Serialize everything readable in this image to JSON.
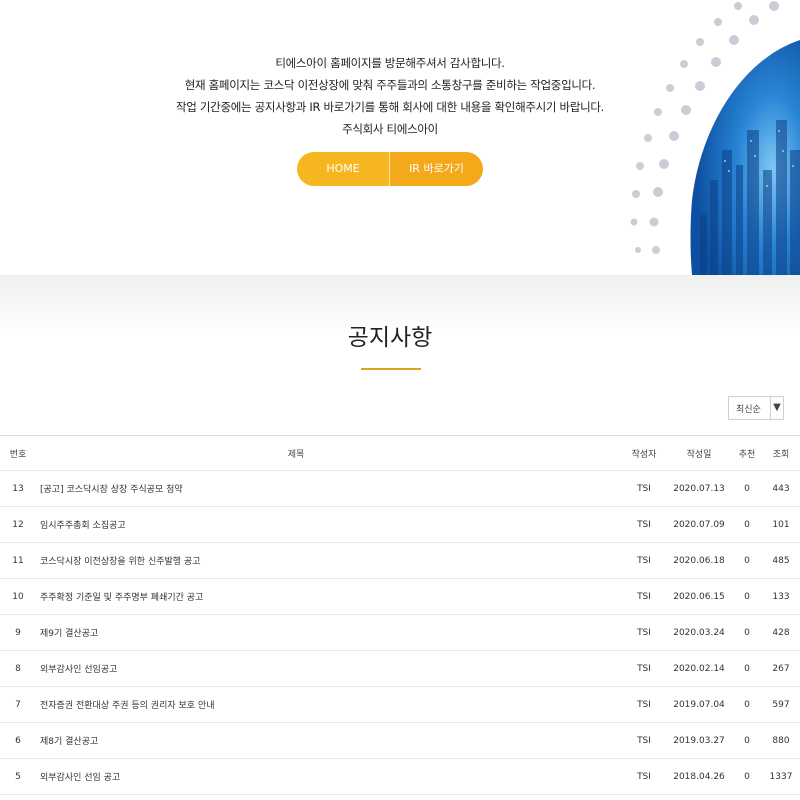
{
  "hero": {
    "lines": [
      "티에스아이 홈페이지를 방문해주셔서 감사합니다.",
      "현재 홈페이지는 코스닥 이전상장에 맞춰 주주들과의 소통창구를 준비하는 작업중입니다.",
      "작업 기간중에는 공지사항과 IR 바로가기를 통해 회사에 대한 내용을 확인해주시기 바랍니다.",
      "주식회사 티에스아이"
    ],
    "home_button": "HOME",
    "ir_button": "IR 바로가기"
  },
  "board": {
    "title": "공지사항",
    "sort_value": "최신순",
    "headers": {
      "num": "번호",
      "subject": "제목",
      "writer": "작성자",
      "date": "작성일",
      "recommend": "추천",
      "views": "조회"
    },
    "rows": [
      {
        "num": "13",
        "subject": "[공고] 코스닥시장 상장 주식공모 청약",
        "writer": "TSI",
        "date": "2020.07.13",
        "recommend": "0",
        "views": "443"
      },
      {
        "num": "12",
        "subject": "임시주주총회 소집공고",
        "writer": "TSI",
        "date": "2020.07.09",
        "recommend": "0",
        "views": "101"
      },
      {
        "num": "11",
        "subject": "코스닥시장 이전상장을 위한 신주발행 공고",
        "writer": "TSI",
        "date": "2020.06.18",
        "recommend": "0",
        "views": "485"
      },
      {
        "num": "10",
        "subject": "주주확정 기준일 및 주주명부 폐쇄기간 공고",
        "writer": "TSI",
        "date": "2020.06.15",
        "recommend": "0",
        "views": "133"
      },
      {
        "num": "9",
        "subject": "제9기 결산공고",
        "writer": "TSI",
        "date": "2020.03.24",
        "recommend": "0",
        "views": "428"
      },
      {
        "num": "8",
        "subject": "외부감사인 선임공고",
        "writer": "TSI",
        "date": "2020.02.14",
        "recommend": "0",
        "views": "267"
      },
      {
        "num": "7",
        "subject": "전자증권 전환대상 주권 등의 권리자 보호 안내",
        "writer": "TSI",
        "date": "2019.07.04",
        "recommend": "0",
        "views": "597"
      },
      {
        "num": "6",
        "subject": "제8기 결산공고",
        "writer": "TSI",
        "date": "2019.03.27",
        "recommend": "0",
        "views": "880"
      },
      {
        "num": "5",
        "subject": "외부감사인 선임 공고",
        "writer": "TSI",
        "date": "2018.04.26",
        "recommend": "0",
        "views": "1337"
      }
    ]
  },
  "colors": {
    "accent": "#f5b61f",
    "accent_dark": "#f3a91a",
    "underline": "#e1a224",
    "globe": "#1d6fc4"
  },
  "icons": {
    "sort_caret": "▼"
  }
}
